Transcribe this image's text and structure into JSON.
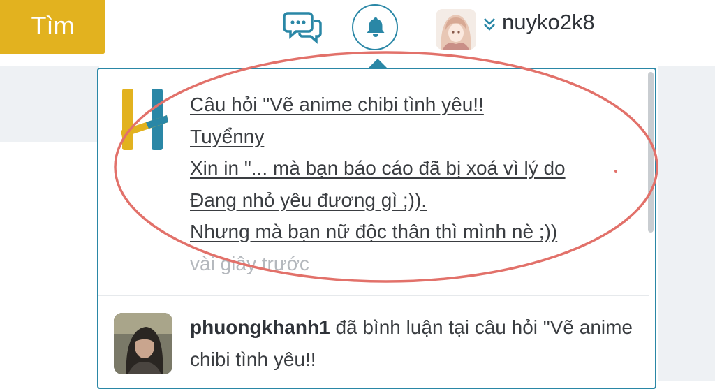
{
  "header": {
    "search_label": "Tìm",
    "username": "nuyko2k8"
  },
  "colors": {
    "accent": "#2a87a6",
    "brand_yellow": "#e2b21f",
    "annotation": "#e2716a"
  },
  "notifications": [
    {
      "lines": [
        "Câu hỏi \"Vẽ anime chibi tình yêu!!",
        "Tuyểnny",
        "Xin in \"... mà bạn báo cáo đã bị xoá vì lý do",
        "Đang nhỏ yêu đương gì ;)).",
        "Nhưng mà bạn nữ độc thân thì mình nè ;))"
      ],
      "time": "vài giây trước"
    },
    {
      "user": "phuongkhanh1",
      "text": "đã bình luận tại câu hỏi \"Vẽ anime chibi tình yêu!!"
    }
  ]
}
